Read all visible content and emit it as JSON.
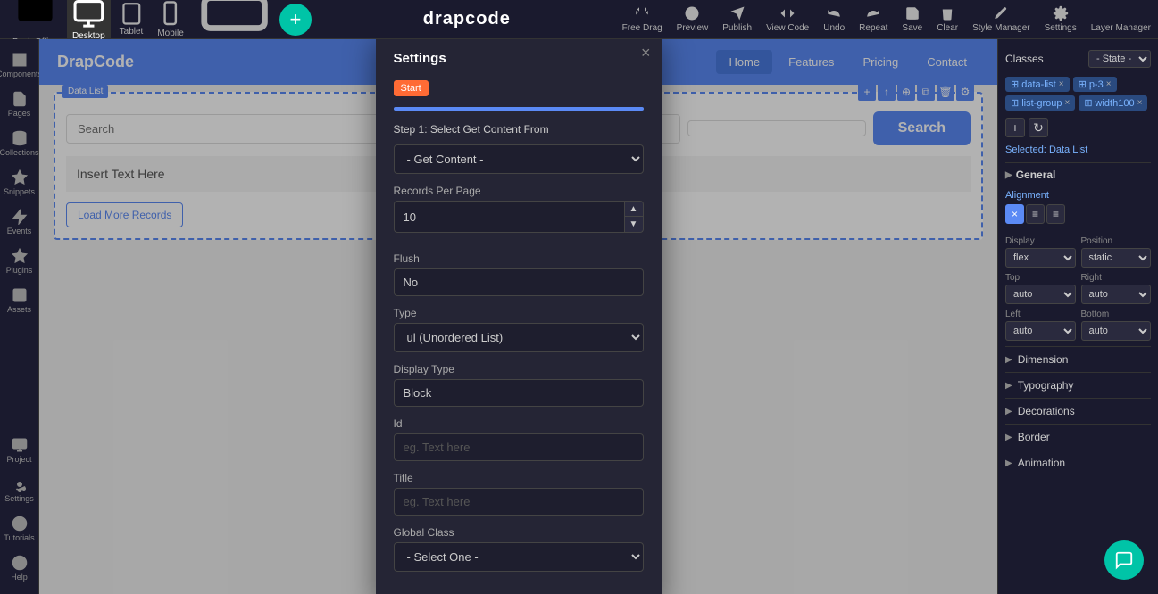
{
  "app": {
    "name": "drapcode",
    "brand": "DrapCode"
  },
  "topbar": {
    "devices": [
      {
        "label": "Desktop",
        "icon": "desktop"
      },
      {
        "label": "Tablet",
        "icon": "tablet"
      },
      {
        "label": "Mobile",
        "icon": "mobile"
      },
      {
        "label": "Mobile Landscape",
        "icon": "mobile-landscape"
      }
    ],
    "actions": [
      {
        "label": "Free Drag",
        "icon": "free-drag"
      },
      {
        "label": "Preview",
        "icon": "preview"
      },
      {
        "label": "Publish",
        "icon": "publish"
      },
      {
        "label": "View Code",
        "icon": "view-code"
      },
      {
        "label": "Undo",
        "icon": "undo"
      },
      {
        "label": "Repeat",
        "icon": "repeat"
      },
      {
        "label": "Save",
        "icon": "save"
      },
      {
        "label": "Clear",
        "icon": "clear"
      },
      {
        "label": "Style Manager",
        "icon": "style-manager"
      },
      {
        "label": "Settings",
        "icon": "settings"
      },
      {
        "label": "Layer Manager",
        "icon": "layer-manager"
      }
    ],
    "back_office": "Back Office"
  },
  "left_sidebar": {
    "items": [
      {
        "label": "Components",
        "icon": "components"
      },
      {
        "label": "Pages",
        "icon": "pages"
      },
      {
        "label": "Collections",
        "icon": "collections"
      },
      {
        "label": "Snippets",
        "icon": "snippets"
      },
      {
        "label": "Events",
        "icon": "events"
      },
      {
        "label": "Plugins",
        "icon": "plugins"
      },
      {
        "label": "Assets",
        "icon": "assets"
      },
      {
        "label": "Project",
        "icon": "project"
      },
      {
        "label": "Settings",
        "icon": "settings"
      },
      {
        "label": "Tutorials",
        "icon": "tutorials"
      },
      {
        "label": "Help",
        "icon": "help"
      }
    ]
  },
  "canvas": {
    "navbar": {
      "brand": "DrapCode",
      "links": [
        "Home",
        "Features",
        "Pricing",
        "Contact"
      ],
      "active_link": "Home"
    },
    "data_list": {
      "label": "Data List",
      "search_placeholder": "Search",
      "search_button": "Search",
      "insert_text": "Insert Text Here",
      "load_more": "Load More Records"
    }
  },
  "right_panel": {
    "classes_label": "Classes",
    "state_label": "- State -",
    "tags": [
      "data-list",
      "p-3",
      "list-group",
      "width100"
    ],
    "selected_label": "Selected:",
    "selected_value": "Data List",
    "sections": {
      "general": "General",
      "alignment": "Alignment",
      "display": {
        "label": "Display",
        "value": "flex"
      },
      "position": {
        "label": "Position",
        "value": "static"
      },
      "top": {
        "label": "Top",
        "value": "auto"
      },
      "right": {
        "label": "Right",
        "value": "auto"
      },
      "left": {
        "label": "Left",
        "value": "auto"
      },
      "bottom": {
        "label": "Bottom",
        "value": "auto"
      },
      "dimension": "Dimension",
      "typography": "Typography",
      "decorations": "Decorations",
      "border": "Border",
      "animation": "Animation"
    },
    "alignment_buttons": [
      "×",
      "≡",
      "≡"
    ]
  },
  "modal": {
    "title": "Settings",
    "start_badge": "Start",
    "step_label": "Step 1: Select Get Content From",
    "get_content_default": "- Get Content -",
    "fields": {
      "records_per_page": {
        "label": "Records Per Page",
        "value": "10"
      },
      "flush": {
        "label": "Flush",
        "value": "No"
      },
      "type": {
        "label": "Type",
        "value": "ul (Unordered List)"
      },
      "display_type": {
        "label": "Display Type",
        "value": "Block"
      },
      "id": {
        "label": "Id",
        "placeholder": "eg. Text here"
      },
      "title": {
        "label": "Title",
        "placeholder": "eg. Text here"
      },
      "global_class": {
        "label": "Global Class",
        "value": "- Select One -"
      }
    }
  }
}
